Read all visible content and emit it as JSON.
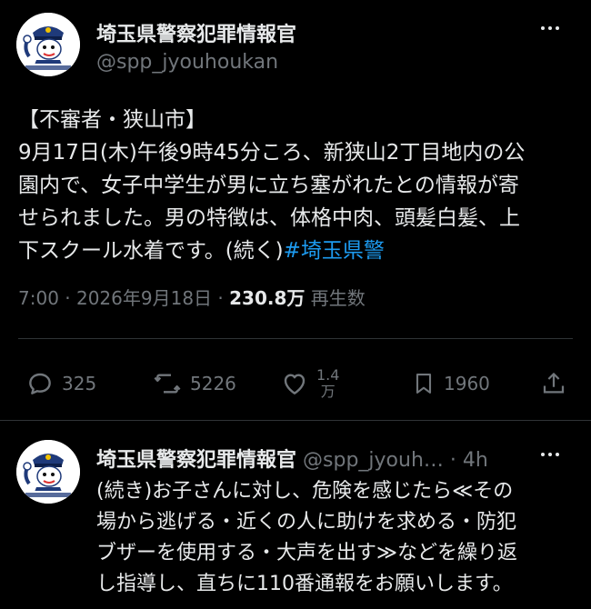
{
  "post": {
    "display_name": "埼玉県警察犯罪情報官",
    "handle": "@spp_jyouhoukan",
    "text_lines": [
      "【不審者・狭山市】",
      "9月17日(木)午後9時45分ころ、新狭山2丁目地内の公",
      "園内で、女子中学生が男に立ち塞がれたとの情報が寄",
      "せられました。男の特徴は、体格中肉、頭髪白髪、上"
    ],
    "last_line_text": "下スクール水着です。(続く)",
    "hashtag": "#埼玉県警",
    "timestamp": "7:00 · 2026年9月18日 ·",
    "views_count": "230.8万",
    "views_label": "再生数"
  },
  "actions": {
    "replies": "325",
    "reposts": "5226",
    "likes_top": "1.4",
    "likes_bottom": "万",
    "bookmarks": "1960"
  },
  "reply": {
    "display_name": "埼玉県警察犯罪情報官",
    "handle_time": "@spp_jyouh… · 4h",
    "text_lines": [
      "(続き)お子さんに対し、危険を感じたら≪その",
      "場から逃げる・近くの人に助けを求める・防犯",
      "ブザーを使用する・大声を出す≫などを繰り返",
      "し指導し、直ちに110番通報をお願いします。"
    ]
  },
  "colors": {
    "background": "#000000",
    "text": "#e7e9ea",
    "muted": "#71767b",
    "link": "#1d9bf0",
    "divider": "#2f3336"
  }
}
